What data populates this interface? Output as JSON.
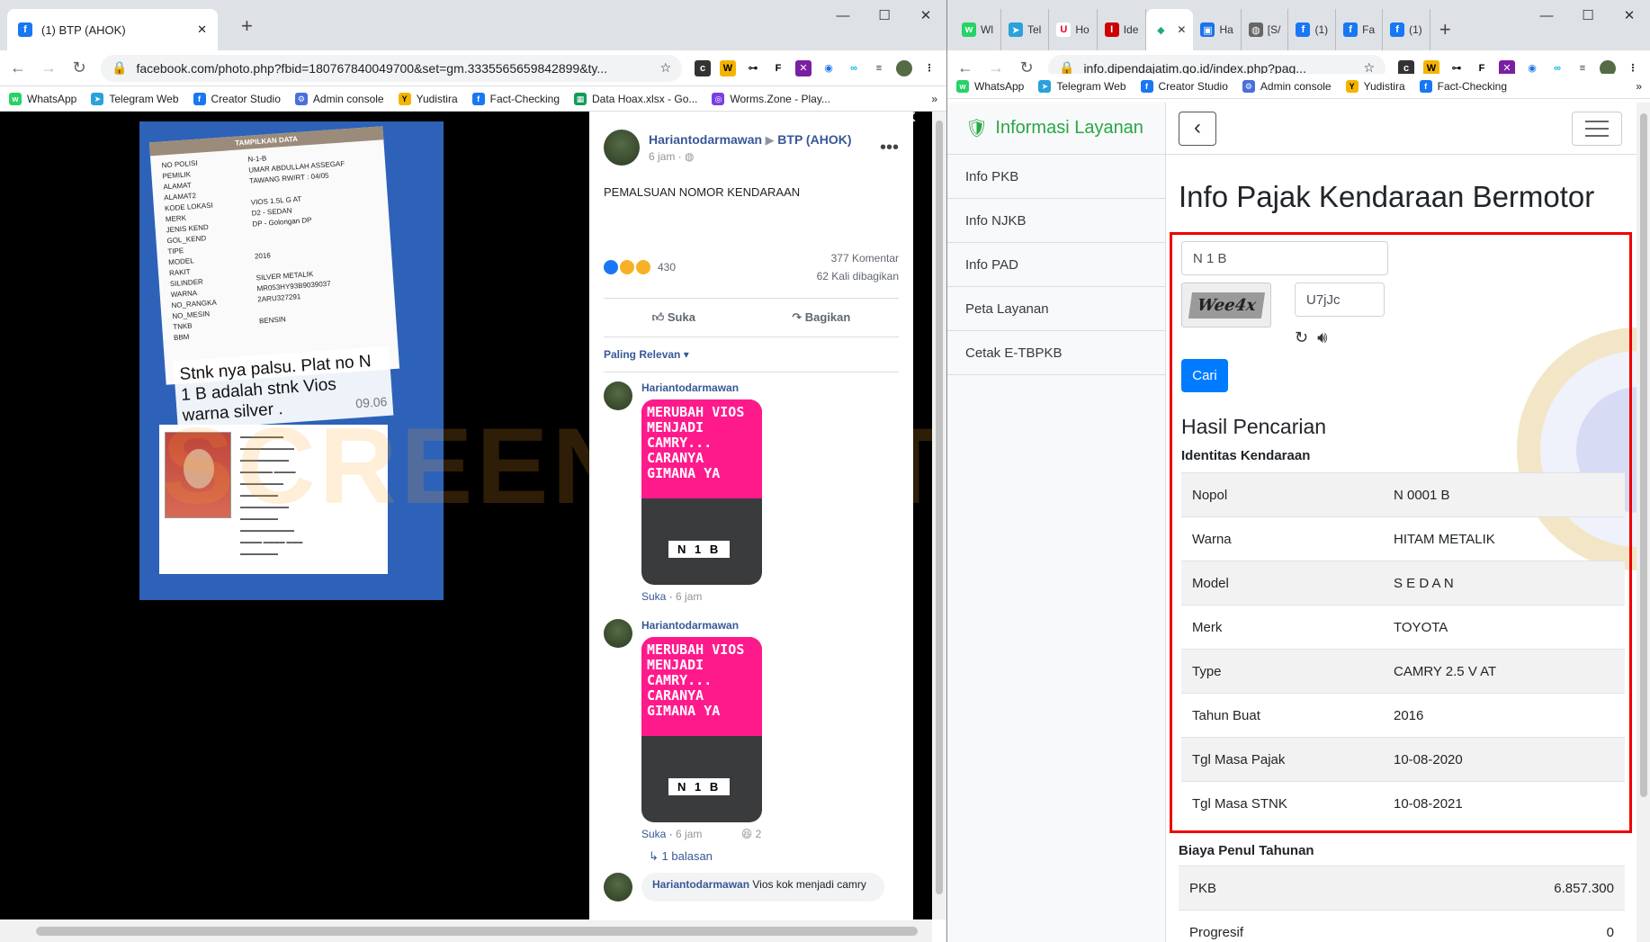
{
  "left": {
    "tab_title": "(1) BTP (AHOK)",
    "url": "facebook.com/photo.php?fbid=180767840049700&set=gm.3335565659842899&ty...",
    "bookmarks": [
      "WhatsApp",
      "Telegram Web",
      "Creator Studio",
      "Admin console",
      "Yudistira",
      "Fact-Checking",
      "Data Hoax.xlsx - Go...",
      "Worms.Zone - Play..."
    ],
    "photo": {
      "doc_header": "TAMPILKAN DATA",
      "doc_rows": [
        [
          "NO POLISI",
          "N-1-B"
        ],
        [
          "PEMILIK",
          "UMAR ABDULLAH ASSEGAF"
        ],
        [
          "ALAMAT",
          "TAWANG RW/RT : 04/05"
        ],
        [
          "ALAMAT2",
          ""
        ],
        [
          "KODE LOKASI",
          "VIOS 1.5L G AT"
        ],
        [
          "MERK",
          "D2 - SEDAN"
        ],
        [
          "JENIS KEND",
          "DP - Golongan DP"
        ],
        [
          "GOL_KEND",
          ""
        ],
        [
          "TIPE",
          ""
        ],
        [
          "MODEL",
          "2016"
        ],
        [
          "RAKIT",
          ""
        ],
        [
          "SILINDER",
          "SILVER METALIK"
        ],
        [
          "WARNA",
          "MR053HY93B9039037"
        ],
        [
          "NO_RANGKA",
          "2ARU327291"
        ],
        [
          "NO_MESIN",
          ""
        ],
        [
          "TNKB",
          "BENSIN"
        ],
        [
          "BBM",
          ""
        ]
      ],
      "note": "Stnk nya palsu. Plat no N 1 B adalah stnk Vios warna silver .",
      "note_time": "09.06"
    },
    "watermark": "SCREENSHOT BY",
    "post": {
      "author": "Hariantodarmawan",
      "group": "BTP (AHOK)",
      "time": "6 jam",
      "text": "PEMALSUAN NOMOR KENDARAAN",
      "reactions": "430",
      "comments": "377 Komentar",
      "shares": "62 Kali dibagikan",
      "like": "Suka",
      "share": "Bagikan",
      "sort": "Paling Relevan"
    },
    "comments": [
      {
        "name": "Hariantodarmawan",
        "meme": "MERUBAH VIOS MENJADI CAMRY... CARANYA GIMANA YA",
        "plate": "N 1 B",
        "like": "Suka",
        "time": "6 jam"
      },
      {
        "name": "Hariantodarmawan",
        "meme": "MERUBAH VIOS MENJADI CAMRY... CARANYA GIMANA YA",
        "plate": "N 1 B",
        "like": "Suka",
        "time": "6 jam",
        "react_count": "2"
      }
    ],
    "replies": "1 balasan",
    "last_comment": {
      "name": "Hariantodarmawan",
      "text": "Vios kok menjadi camry"
    }
  },
  "right": {
    "tabs": [
      "Wl",
      "Tel",
      "Ho",
      "Ide",
      "",
      "Ha",
      "[S/",
      "(1)",
      "Fa",
      "(1)"
    ],
    "url": "info.dipendajatim.go.id/index.php?pag...",
    "bookmarks": [
      "WhatsApp",
      "Telegram Web",
      "Creator Studio",
      "Admin console",
      "Yudistira",
      "Fact-Checking"
    ],
    "brand": "Informasi Layanan",
    "menu": [
      "Info PKB",
      "Info NJKB",
      "Info PAD",
      "Peta Layanan",
      "Cetak E-TBPKB"
    ],
    "title": "Info Pajak Kendaraan Bermotor",
    "nopol_input": "N 1 B",
    "captcha_text": "Wee4x",
    "captcha_input": "U7jJc",
    "search_button": "Cari",
    "result_title": "Hasil Pencarian",
    "identity_title": "Identitas Kendaraan",
    "identity": [
      [
        "Nopol",
        "N 0001 B"
      ],
      [
        "Warna",
        "HITAM METALIK"
      ],
      [
        "Model",
        "S E D A N"
      ],
      [
        "Merk",
        "TOYOTA"
      ],
      [
        "Type",
        "CAMRY 2.5 V AT"
      ],
      [
        "Tahun Buat",
        "2016"
      ],
      [
        "Tgl Masa Pajak",
        "10-08-2020"
      ],
      [
        "Tgl Masa STNK",
        "10-08-2021"
      ]
    ],
    "fee_title": "Biaya Penul Tahunan",
    "fees": [
      [
        "PKB",
        "6.857.300"
      ],
      [
        "Progresif",
        "0"
      ]
    ]
  }
}
